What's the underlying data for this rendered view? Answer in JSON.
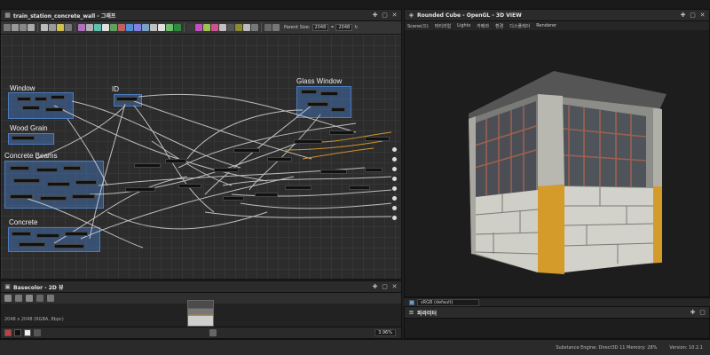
{
  "graph_panel": {
    "title": "train_station_concrete_wall - 그래프",
    "parent_size_label": "Parent Size:",
    "parent_size_value": "2048",
    "size_value": "2048",
    "frames": [
      {
        "label": "Window"
      },
      {
        "label": "ID"
      },
      {
        "label": "Glass Window"
      },
      {
        "label": "Wood Grain"
      },
      {
        "label": "Concrete Beams"
      },
      {
        "label": "Concrete"
      }
    ]
  },
  "view2d": {
    "title": "Basecolor - 2D 뷰",
    "info": "2048 x 2048 (RGBA, 8bpc)",
    "zoom": "3.96%"
  },
  "view3d": {
    "title": "Rounded Cube - OpenGL - 3D VIEW",
    "menu": [
      "Scene(으)",
      "머티리얼",
      "Lights",
      "카메라",
      "환경",
      "디스플레이",
      "Renderer"
    ]
  },
  "colorspace": {
    "value": "sRGB (default)"
  },
  "params": {
    "title": "파라미터"
  },
  "status": {
    "engine": "Substance Engine: Direct3D 11  Memory: 28%",
    "version": "Version: 10.2.1"
  },
  "icons": {
    "pin": "pin-icon",
    "float": "float-icon",
    "close": "close-icon"
  }
}
